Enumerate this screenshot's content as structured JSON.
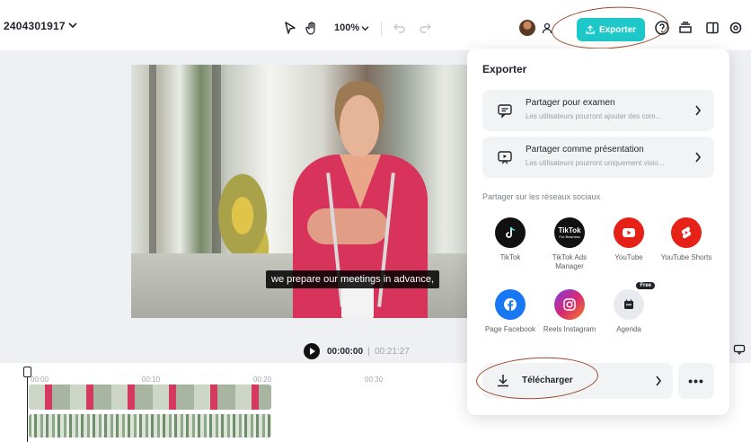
{
  "header": {
    "project_title": "2404301917",
    "zoom": "100%",
    "export_label": "Exporter"
  },
  "preview": {
    "caption": "we prepare our meetings in advance,"
  },
  "playback": {
    "current_time": "00:00:00",
    "separator": "|",
    "total_time": "00:21:27"
  },
  "timeline": {
    "ruler": [
      "00:00",
      "00:10",
      "00:20",
      "00:30"
    ]
  },
  "export_panel": {
    "title": "Exporter",
    "share_review": {
      "title": "Partager pour examen",
      "subtitle": "Les utilisateurs pourront ajouter des com..."
    },
    "share_presentation": {
      "title": "Partager comme présentation",
      "subtitle": "Les utilisateurs pourront uniquement visio..."
    },
    "social_heading": "Partager sur les réseaux sociaux",
    "socials": [
      {
        "label": "TikTok",
        "icon": "tiktok-icon",
        "color": "#111111"
      },
      {
        "label": "TikTok Ads Manager",
        "icon": "tiktok-ads-icon",
        "color": "#111111"
      },
      {
        "label": "YouTube",
        "icon": "youtube-icon",
        "color": "#e62117"
      },
      {
        "label": "YouTube Shorts",
        "icon": "youtube-shorts-icon",
        "color": "#e62117"
      },
      {
        "label": "Page Facebook",
        "icon": "facebook-icon",
        "color": "#1877f2"
      },
      {
        "label": "Reels Instagram",
        "icon": "instagram-icon",
        "color": "#d62976"
      },
      {
        "label": "Agenda",
        "icon": "calendar-icon",
        "color": "#e8eaee"
      }
    ],
    "tiktok_ads_logo_text": "TikTok",
    "tiktok_ads_logo_sub": "For Business",
    "free_badge": "Free",
    "download_label": "Télécharger",
    "more_label": "•••"
  },
  "colors": {
    "accent": "#1ec8c8",
    "annotation": "#9a4a2a"
  }
}
